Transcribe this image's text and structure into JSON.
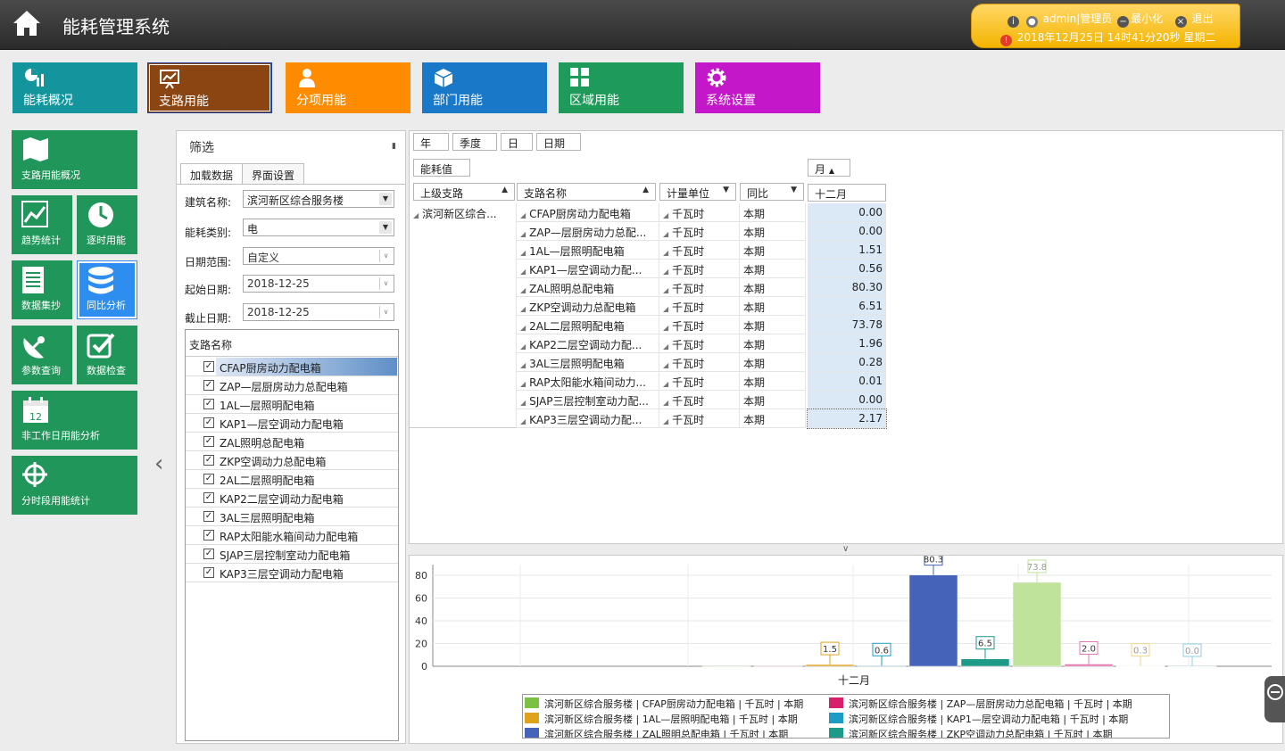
{
  "header": {
    "title": "能耗管理系统",
    "user": "admin|管理员",
    "minimize": "最小化",
    "logout": "退出",
    "datetime": "2018年12月25日 14时41分20秒 星期二"
  },
  "modules": [
    {
      "label": "能耗概况",
      "color": "#14959e"
    },
    {
      "label": "支路用能",
      "color": "#8b4513"
    },
    {
      "label": "分项用能",
      "color": "#ff8c00"
    },
    {
      "label": "部门用能",
      "color": "#1a78c9"
    },
    {
      "label": "区域用能",
      "color": "#1e9b5a"
    },
    {
      "label": "系统设置",
      "color": "#c417c9"
    }
  ],
  "leftnav": {
    "overview": "支路用能概况",
    "trend": "趋势统计",
    "hourly": "逐时用能",
    "collect": "数据集抄",
    "compare": "同比分析",
    "param": "参数查询",
    "check": "数据检查",
    "calendar_day": "12",
    "nonwork": "非工作日用能分析",
    "period": "分时段用能统计"
  },
  "filter": {
    "title": "筛选",
    "tab_load": "加载数据",
    "tab_ui": "界面设置",
    "building_label": "建筑名称:",
    "building_value": "滨河新区综合服务楼",
    "energy_label": "能耗类别:",
    "energy_value": "电",
    "range_label": "日期范围:",
    "range_value": "自定义",
    "start_label": "起始日期:",
    "start_value": "2018-12-25",
    "end_label": "截止日期:",
    "end_value": "2018-12-25",
    "list_header": "支路名称",
    "branches": [
      "CFAP厨房动力配电箱",
      "ZAP—层厨房动力总配电箱",
      "1AL—层照明配电箱",
      "KAP1—层空调动力配电箱",
      "ZAL照明总配电箱",
      "ZKP空调动力总配电箱",
      "2AL二层照明配电箱",
      "KAP2二层空调动力配电箱",
      "3AL三层照明配电箱",
      "RAP太阳能水箱间动力配电箱",
      "SJAP三层控制室动力配电箱",
      "KAP3三层空调动力配电箱"
    ]
  },
  "grid": {
    "filter_year": "年",
    "filter_quarter": "季度",
    "filter_day": "日",
    "filter_date": "日期",
    "data_field": "能耗值",
    "month_field": "月",
    "col_parent": "上级支路",
    "col_branch": "支路名称",
    "col_unit": "计量单位",
    "col_yoy": "同比",
    "col_month": "十二月",
    "parent_value": "滨河新区综合...",
    "rows": [
      {
        "branch": "CFAP厨房动力配电箱",
        "unit": "千瓦时",
        "period": "本期",
        "value": "0.00"
      },
      {
        "branch": "ZAP—层厨房动力总配...",
        "unit": "千瓦时",
        "period": "本期",
        "value": "0.00"
      },
      {
        "branch": "1AL—层照明配电箱",
        "unit": "千瓦时",
        "period": "本期",
        "value": "1.51"
      },
      {
        "branch": "KAP1—层空调动力配...",
        "unit": "千瓦时",
        "period": "本期",
        "value": "0.56"
      },
      {
        "branch": "ZAL照明总配电箱",
        "unit": "千瓦时",
        "period": "本期",
        "value": "80.30"
      },
      {
        "branch": "ZKP空调动力总配电箱",
        "unit": "千瓦时",
        "period": "本期",
        "value": "6.51"
      },
      {
        "branch": "2AL二层照明配电箱",
        "unit": "千瓦时",
        "period": "本期",
        "value": "73.78"
      },
      {
        "branch": "KAP2二层空调动力配...",
        "unit": "千瓦时",
        "period": "本期",
        "value": "1.96"
      },
      {
        "branch": "3AL三层照明配电箱",
        "unit": "千瓦时",
        "period": "本期",
        "value": "0.28"
      },
      {
        "branch": "RAP太阳能水箱间动力...",
        "unit": "千瓦时",
        "period": "本期",
        "value": "0.01"
      },
      {
        "branch": "SJAP三层控制室动力配...",
        "unit": "千瓦时",
        "period": "本期",
        "value": "0.00"
      },
      {
        "branch": "KAP3三层空调动力配...",
        "unit": "千瓦时",
        "period": "本期",
        "value": "2.17"
      }
    ]
  },
  "chart_data": {
    "type": "bar",
    "categories": [
      "十二月"
    ],
    "yticks": [
      "0",
      "20",
      "40",
      "60",
      "80"
    ],
    "ylim": [
      0,
      80
    ],
    "series": [
      {
        "name": "滨河新区综合服务楼 | CFAP厨房动力配电箱 | 千瓦时 | 本期",
        "value": 0.0,
        "label": "",
        "color": "#7bc142"
      },
      {
        "name": "滨河新区综合服务楼 | ZAP—层厨房动力总配电箱 | 千瓦时 | 本期",
        "value": 0.0,
        "label": "",
        "color": "#d91f6b"
      },
      {
        "name": "滨河新区综合服务楼 | 1AL—层照明配电箱 | 千瓦时 | 本期",
        "value": 1.51,
        "label": "1.5",
        "color": "#e0a21a"
      },
      {
        "name": "滨河新区综合服务楼 | KAP1—层空调动力配电箱 | 千瓦时 | 本期",
        "value": 0.56,
        "label": "0.6",
        "color": "#1c9bc4"
      },
      {
        "name": "滨河新区综合服务楼 | ZAL照明总配电箱 | 千瓦时 | 本期",
        "value": 80.3,
        "label": "80.3",
        "color": "#4563b8"
      },
      {
        "name": "滨河新区综合服务楼 | ZKP空调动力总配电箱 | 千瓦时 | 本期",
        "value": 6.51,
        "label": "6.5",
        "color": "#1e9a88"
      },
      {
        "name": "2AL二层照明配电箱",
        "value": 73.78,
        "label": "73.8",
        "color": "#bfe39a"
      },
      {
        "name": "KAP2二层空调动力配电箱",
        "value": 1.96,
        "label": "2.0",
        "color": "#e478b0"
      },
      {
        "name": "3AL三层照明配电箱",
        "value": 0.28,
        "label": "0.3",
        "color": "#f0d68c"
      },
      {
        "name": "RAP太阳能水箱间动力配电箱",
        "value": 0.01,
        "label": "0.0",
        "color": "#8fd0e6"
      }
    ],
    "legend_placement": "bottom",
    "grid": true
  }
}
